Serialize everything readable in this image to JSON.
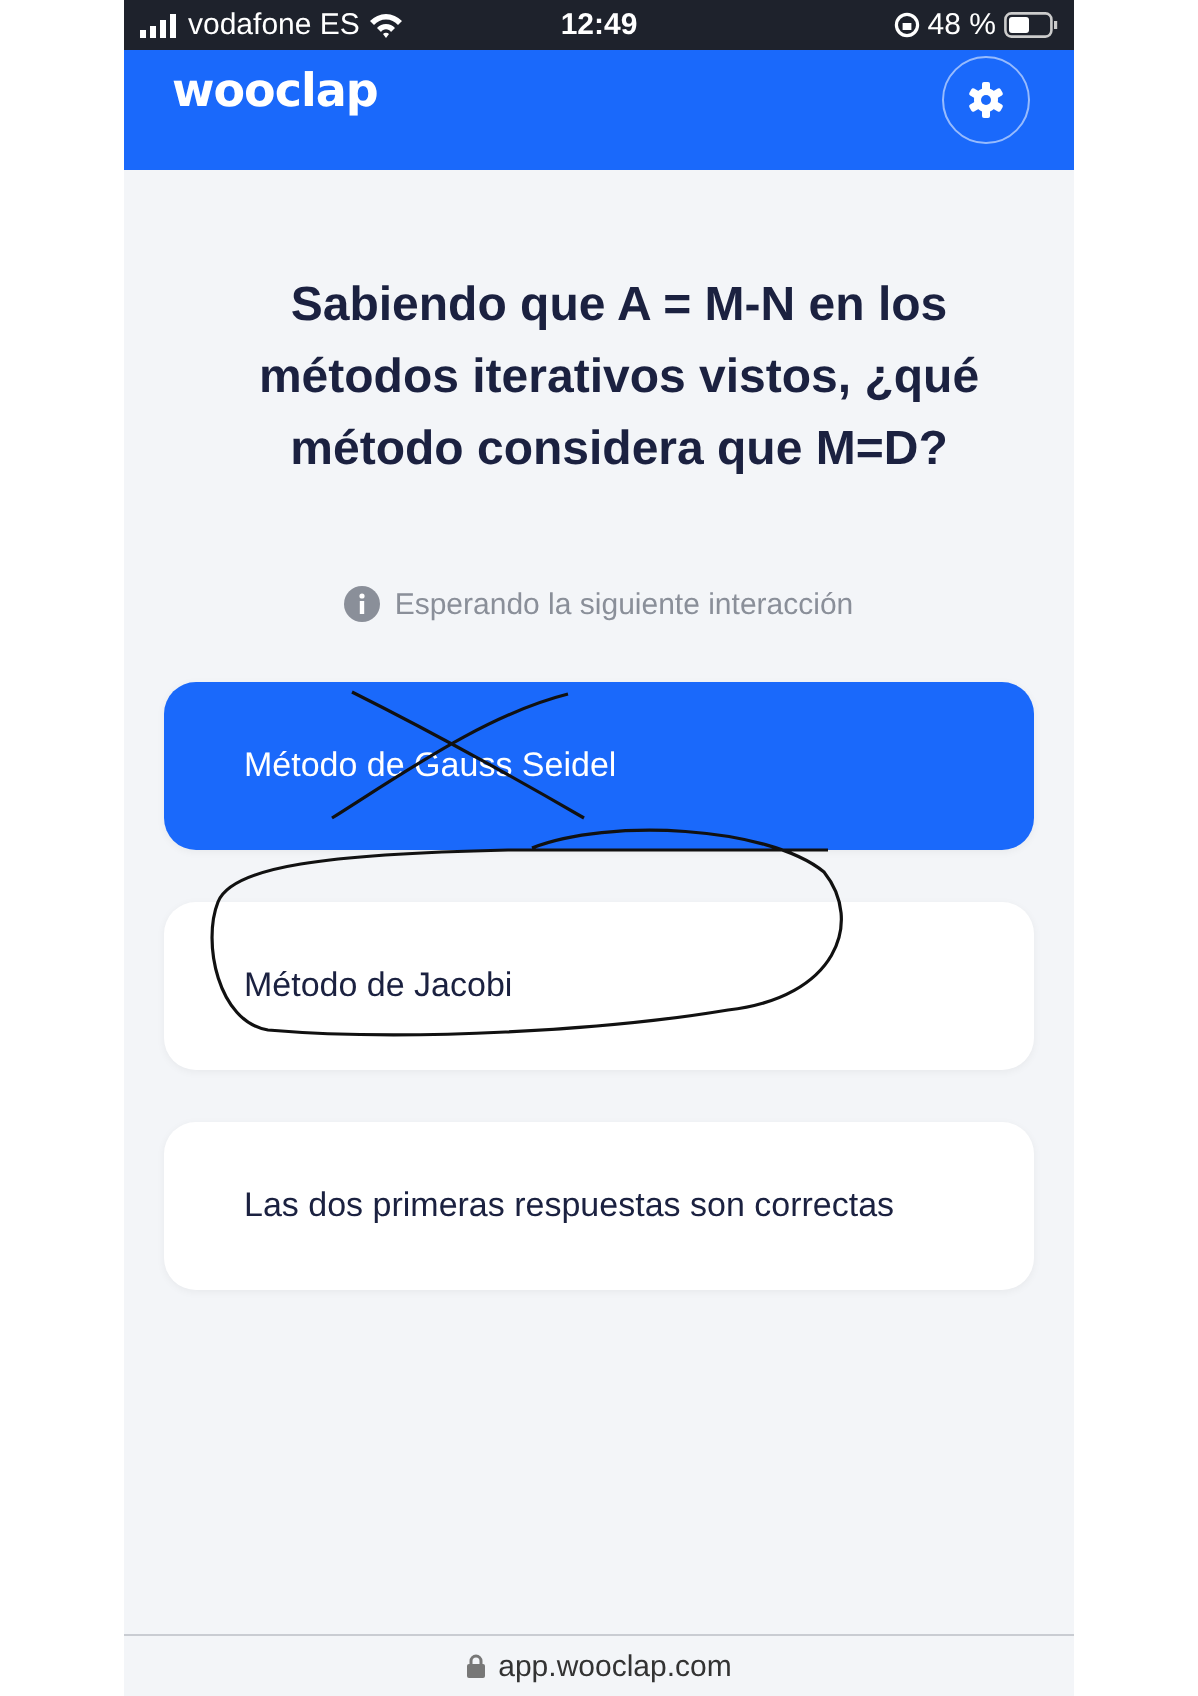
{
  "status_bar": {
    "carrier": "vodafone ES",
    "time": "12:49",
    "battery": "48 %"
  },
  "header": {
    "logo": "wooclap"
  },
  "question": {
    "title": "Sabiendo que A = M-N en los métodos iterativos vistos, ¿qué método considera que M=D?",
    "status": "Esperando la siguiente interacción"
  },
  "options": [
    {
      "label": "Método de Gauss Seidel",
      "selected": true,
      "crossed": true,
      "circled": false
    },
    {
      "label": "Método de Jacobi",
      "selected": false,
      "crossed": false,
      "circled": true
    },
    {
      "label": "Las dos primeras respuestas son correctas",
      "selected": false,
      "crossed": false,
      "circled": false
    }
  ],
  "url_bar": {
    "url": "app.wooclap.com"
  }
}
